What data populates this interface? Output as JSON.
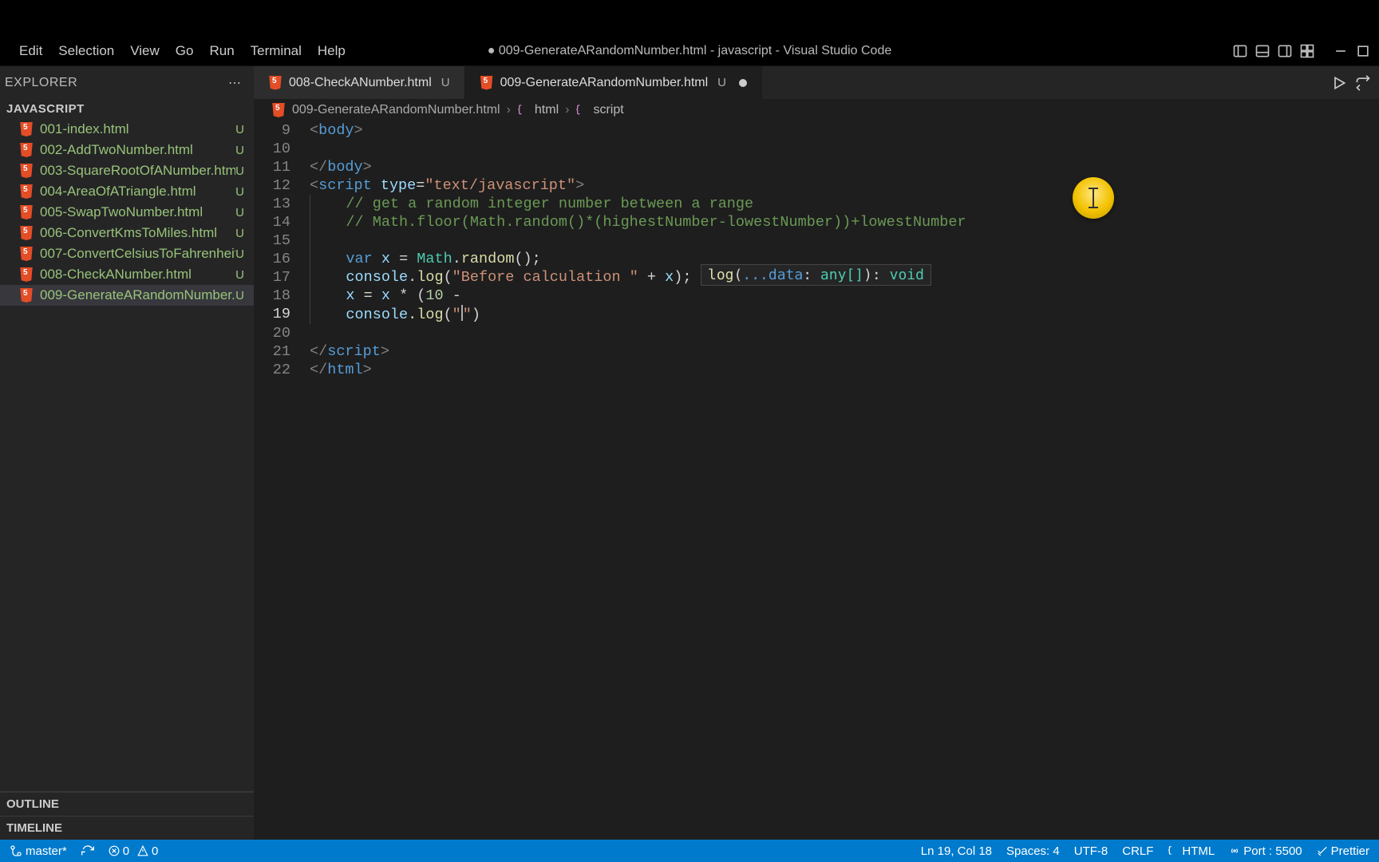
{
  "menu": [
    "Edit",
    "Selection",
    "View",
    "Go",
    "Run",
    "Terminal",
    "Help"
  ],
  "window_title": "● 009-GenerateARandomNumber.html - javascript - Visual Studio Code",
  "explorer": {
    "title": "EXPLORER",
    "section": "JAVASCRIPT",
    "files": [
      {
        "name": "001-index.html",
        "badge": "U"
      },
      {
        "name": "002-AddTwoNumber.html",
        "badge": "U"
      },
      {
        "name": "003-SquareRootOfANumber.html",
        "badge": "U"
      },
      {
        "name": "004-AreaOfATriangle.html",
        "badge": "U"
      },
      {
        "name": "005-SwapTwoNumber.html",
        "badge": "U"
      },
      {
        "name": "006-ConvertKmsToMiles.html",
        "badge": "U"
      },
      {
        "name": "007-ConvertCelsiusToFahrenheit...",
        "badge": "U"
      },
      {
        "name": "008-CheckANumber.html",
        "badge": "U"
      },
      {
        "name": "009-GenerateARandomNumber....",
        "badge": "U"
      }
    ],
    "outline": "OUTLINE",
    "timeline": "TIMELINE"
  },
  "tabs": [
    {
      "name": "008-CheckANumber.html",
      "badge": "U",
      "modified": false,
      "active": false
    },
    {
      "name": "009-GenerateARandomNumber.html",
      "badge": "U",
      "modified": true,
      "active": true
    }
  ],
  "breadcrumb": {
    "file": "009-GenerateARandomNumber.html",
    "path": [
      "html",
      "script"
    ]
  },
  "param_hint": {
    "fn": "log",
    "sig": "(...data: any[]): void"
  },
  "code": {
    "lines": [
      {
        "n": 9,
        "ind": 0,
        "seg": [
          [
            "pun",
            "<"
          ],
          [
            "tag",
            "body"
          ],
          [
            "pun",
            ">"
          ]
        ]
      },
      {
        "n": 10,
        "ind": 0,
        "seg": []
      },
      {
        "n": 11,
        "ind": 0,
        "seg": [
          [
            "pun",
            "</"
          ],
          [
            "tag",
            "body"
          ],
          [
            "pun",
            ">"
          ]
        ]
      },
      {
        "n": 12,
        "ind": 0,
        "seg": [
          [
            "pun",
            "<"
          ],
          [
            "tag",
            "script"
          ],
          [
            "txt",
            " "
          ],
          [
            "attr",
            "type"
          ],
          [
            "op",
            "="
          ],
          [
            "str",
            "\"text/javascript\""
          ],
          [
            "pun",
            ">"
          ]
        ]
      },
      {
        "n": 13,
        "ind": 1,
        "seg": [
          [
            "cmt",
            "// get a random integer number between a range"
          ]
        ]
      },
      {
        "n": 14,
        "ind": 1,
        "seg": [
          [
            "cmt",
            "// Math.floor(Math.random()*(highestNumber-lowestNumber))+lowestNumber"
          ]
        ]
      },
      {
        "n": 15,
        "ind": 1,
        "seg": []
      },
      {
        "n": 16,
        "ind": 1,
        "seg": [
          [
            "kw",
            "var"
          ],
          [
            "txt",
            " "
          ],
          [
            "var",
            "x"
          ],
          [
            "txt",
            " "
          ],
          [
            "op",
            "="
          ],
          [
            "txt",
            " "
          ],
          [
            "obj",
            "Math"
          ],
          [
            "op",
            "."
          ],
          [
            "fn",
            "random"
          ],
          [
            "op",
            "();"
          ]
        ]
      },
      {
        "n": 17,
        "ind": 1,
        "seg": [
          [
            "var",
            "console"
          ],
          [
            "op",
            "."
          ],
          [
            "fn",
            "log"
          ],
          [
            "op",
            "("
          ],
          [
            "str",
            "\"Before calculation \""
          ],
          [
            "txt",
            " "
          ],
          [
            "op",
            "+"
          ],
          [
            "txt",
            " "
          ],
          [
            "var",
            "x"
          ],
          [
            "op",
            ");"
          ]
        ]
      },
      {
        "n": 18,
        "ind": 1,
        "seg": [
          [
            "var",
            "x"
          ],
          [
            "txt",
            " "
          ],
          [
            "op",
            "="
          ],
          [
            "txt",
            " "
          ],
          [
            "var",
            "x"
          ],
          [
            "txt",
            " "
          ],
          [
            "op",
            "*"
          ],
          [
            "txt",
            " "
          ],
          [
            "op",
            "("
          ],
          [
            "num",
            "10"
          ],
          [
            "txt",
            " "
          ],
          [
            "op",
            "-"
          ]
        ]
      },
      {
        "n": 19,
        "ind": 1,
        "current": true,
        "seg": [
          [
            "var",
            "console"
          ],
          [
            "op",
            "."
          ],
          [
            "fn",
            "log"
          ],
          [
            "op",
            "("
          ],
          [
            "str",
            "\""
          ],
          [
            "caret",
            ""
          ],
          [
            "str",
            "\""
          ],
          [
            "op",
            ")"
          ]
        ]
      },
      {
        "n": 20,
        "ind": 0,
        "seg": []
      },
      {
        "n": 21,
        "ind": 0,
        "seg": [
          [
            "pun",
            "</"
          ],
          [
            "tag",
            "script"
          ],
          [
            "pun",
            ">"
          ]
        ]
      },
      {
        "n": 22,
        "ind": 0,
        "seg": [
          [
            "pun",
            "</"
          ],
          [
            "tag",
            "html"
          ],
          [
            "pun",
            ">"
          ]
        ]
      }
    ]
  },
  "status": {
    "branch": "master*",
    "errors": "0",
    "warnings": "0",
    "cursor": "Ln 19, Col 18",
    "spaces": "Spaces: 4",
    "encoding": "UTF-8",
    "eol": "CRLF",
    "language": "HTML",
    "port": "Port : 5500",
    "prettier": "Prettier"
  }
}
